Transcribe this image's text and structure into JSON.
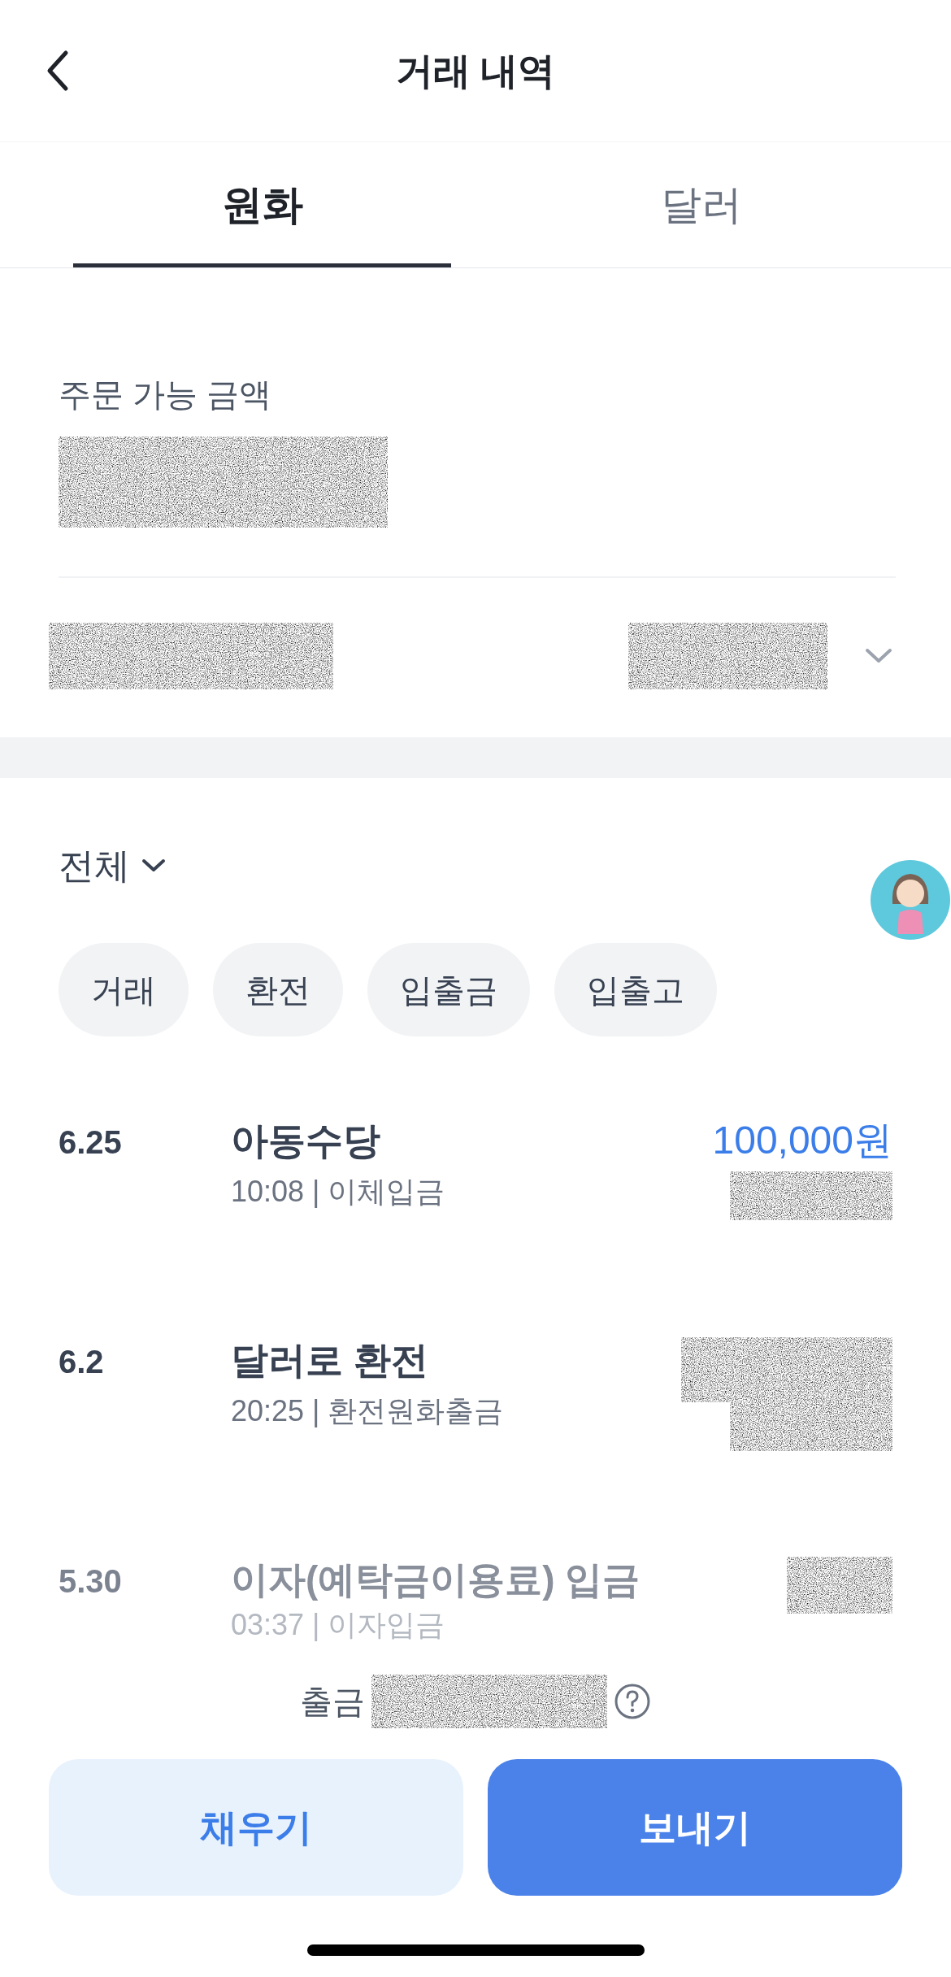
{
  "header": {
    "title": "거래 내역"
  },
  "tabs": [
    {
      "label": "원화",
      "selected": true
    },
    {
      "label": "달러",
      "selected": false
    }
  ],
  "balance": {
    "label": "주문 가능 금액"
  },
  "filter": {
    "label": "전체"
  },
  "chips": [
    {
      "label": "거래",
      "selected": false
    },
    {
      "label": "환전",
      "selected": false
    },
    {
      "label": "입출금",
      "selected": false
    },
    {
      "label": "입출고",
      "selected": false
    }
  ],
  "transactions": [
    {
      "date": "6.25",
      "title": "아동수당",
      "detail": "10:08 | 이체입금",
      "amount": "100,000원",
      "dimmed": false
    },
    {
      "date": "6.2",
      "title": "달러로 환전",
      "detail": "20:25 | 환전원화출금",
      "dimmed": false
    },
    {
      "date": "5.30",
      "title": "이자(예탁금이용료) 입금",
      "detail": "03:37 | 이자입금",
      "dimmed": true
    }
  ],
  "withdraw": {
    "label": "출금"
  },
  "buttons": [
    {
      "label": "채우기",
      "kind": "secondary"
    },
    {
      "label": "보내기",
      "kind": "primary"
    }
  ]
}
